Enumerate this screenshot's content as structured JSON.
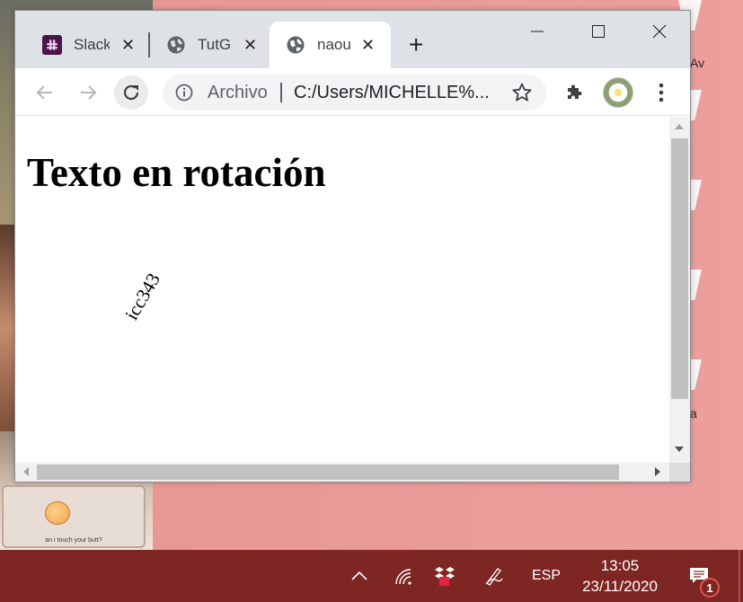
{
  "desktop": {
    "card_caption": "an i touch your butt?",
    "right_labels": [
      "Av",
      "a"
    ]
  },
  "browser": {
    "tabs": [
      {
        "title": "Slack",
        "icon": "slack-icon",
        "active": false
      },
      {
        "title": "TutG",
        "icon": "globe-icon",
        "active": false
      },
      {
        "title": "naou",
        "icon": "globe-icon",
        "active": true
      }
    ],
    "new_tab_label": "+",
    "window_controls": [
      "minimize",
      "maximize",
      "close"
    ],
    "toolbar": {
      "back": "back-arrow-icon",
      "forward": "forward-arrow-icon",
      "reload": "reload-icon",
      "scheme_label": "Archivo",
      "url": "C:/Users/MICHELLE%...",
      "bookmark": "star-icon",
      "extensions": "puzzle-icon",
      "menu": "kebab-menu-icon"
    }
  },
  "page": {
    "heading": "Texto en rotación",
    "rotated_text": "icc343"
  },
  "taskbar": {
    "language": "ESP",
    "time": "13:05",
    "date": "23/11/2020",
    "notification_count": "1"
  }
}
